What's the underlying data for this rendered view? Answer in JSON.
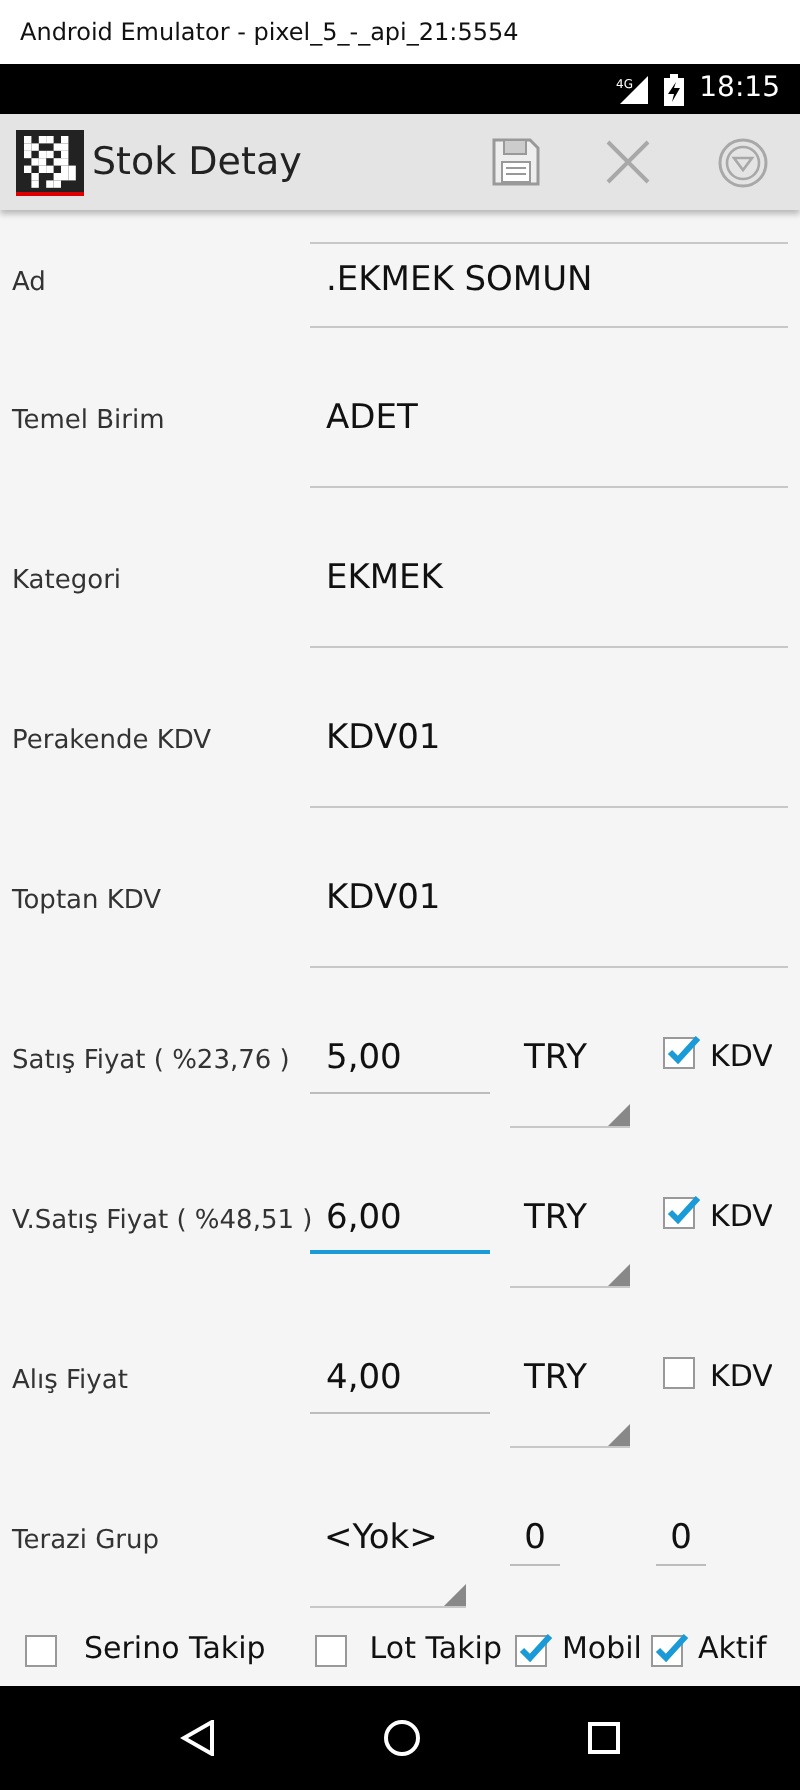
{
  "window": {
    "title": "Android Emulator - pixel_5_-_api_21:5554"
  },
  "status_bar": {
    "network": "4G",
    "time": "18:15"
  },
  "app_bar": {
    "title": "Stok Detay"
  },
  "fields": [
    {
      "label": "Ad",
      "value": ".EKMEK SOMUN",
      "disabled": false
    },
    {
      "label": "Temel Birim",
      "value": "ADET",
      "disabled": false
    },
    {
      "label": "Kategori",
      "value": "EKMEK",
      "disabled": false
    },
    {
      "label": "Perakende KDV",
      "value": "KDV01",
      "disabled": false
    },
    {
      "label": "Toptan KDV",
      "value": "KDV01",
      "disabled": false
    }
  ],
  "prices": [
    {
      "label": "Satış Fiyat ( %23,76 )",
      "value": "5,00",
      "focused": false,
      "currency": "TRY",
      "kdv_label": "KDV",
      "kdv_checked": true
    },
    {
      "label": "V.Satış Fiyat ( %48,51 )",
      "value": "6,00",
      "focused": true,
      "currency": "TRY",
      "kdv_label": "KDV",
      "kdv_checked": true
    },
    {
      "label": "Alış Fiyat",
      "value": "4,00",
      "focused": false,
      "currency": "TRY",
      "kdv_label": "KDV",
      "kdv_checked": false
    }
  ],
  "scale_group": {
    "label": "Terazi Grup",
    "value": "<Yok>",
    "number_1": "0",
    "number_2": "0"
  },
  "options": [
    {
      "label": "Serino Takip",
      "checked": false
    },
    {
      "label": "Lot Takip",
      "checked": false
    },
    {
      "label": "Mobil",
      "checked": true
    },
    {
      "label": "Aktif",
      "checked": true
    }
  ]
}
